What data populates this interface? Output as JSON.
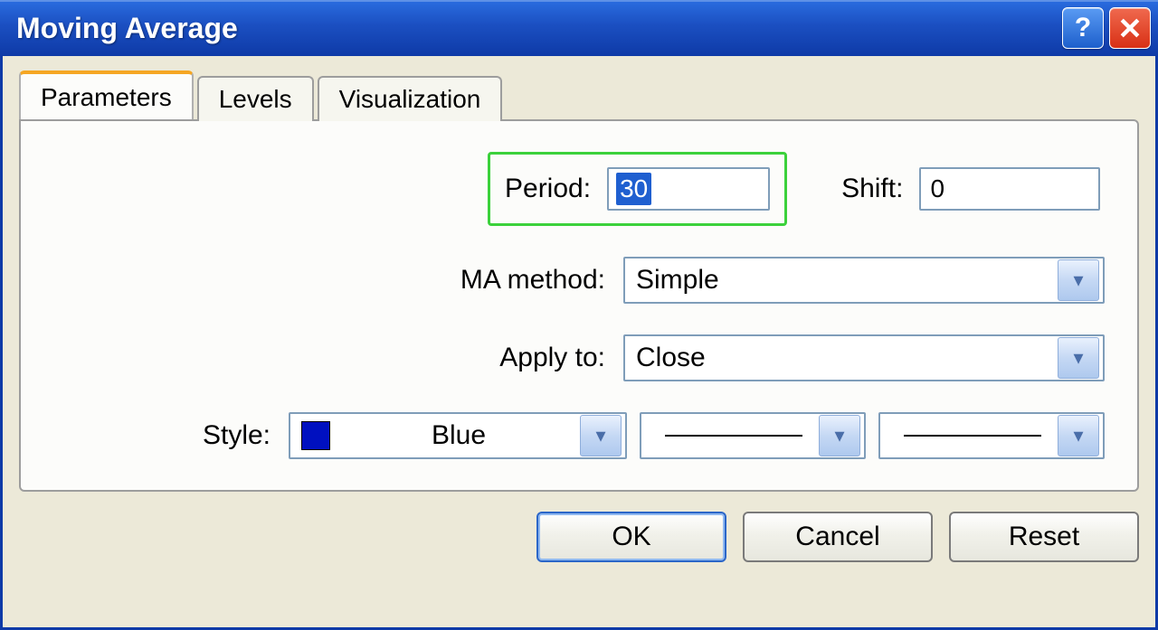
{
  "window": {
    "title": "Moving Average"
  },
  "tabs": {
    "parameters": "Parameters",
    "levels": "Levels",
    "visualization": "Visualization"
  },
  "fields": {
    "period": {
      "label": "Period:",
      "value": "30"
    },
    "shift": {
      "label": "Shift:",
      "value": "0"
    },
    "ma_method": {
      "label": "MA method:",
      "value": "Simple"
    },
    "apply_to": {
      "label": "Apply to:",
      "value": "Close"
    },
    "style": {
      "label": "Style:",
      "color_name": "Blue",
      "color_hex": "#0010C0"
    }
  },
  "buttons": {
    "ok": "OK",
    "cancel": "Cancel",
    "reset": "Reset"
  }
}
